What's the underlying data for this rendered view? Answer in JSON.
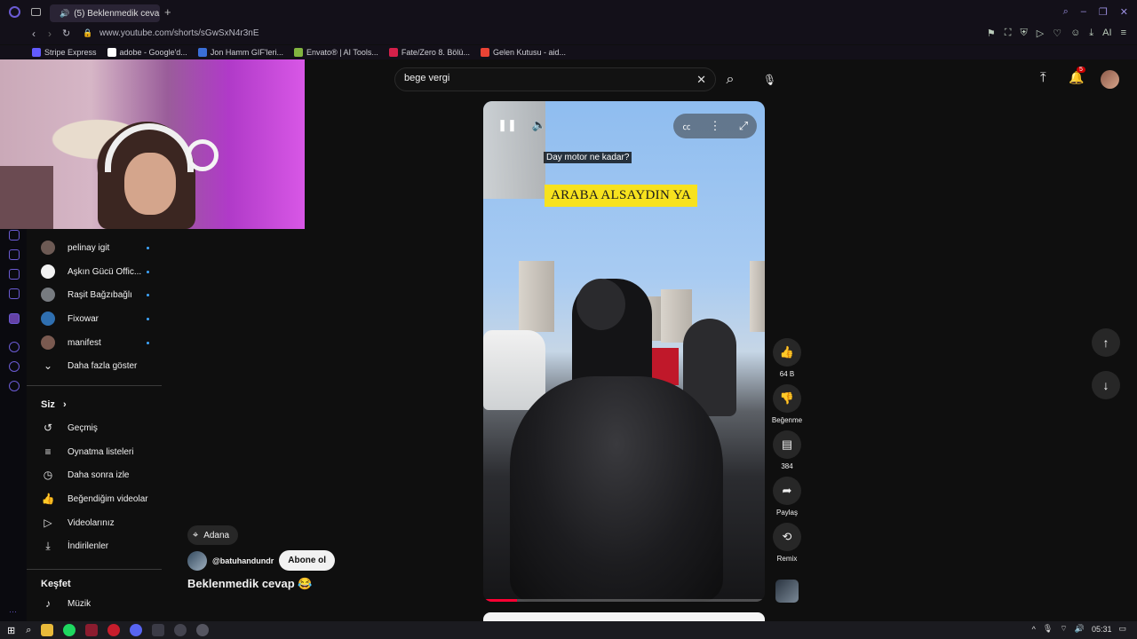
{
  "browser": {
    "tab_title": "(5) Beklenmedik cevap",
    "url": "www.youtube.com/shorts/sGwSxN4r3nE",
    "bookmarks": [
      {
        "label": "Stripe Express",
        "color": "#635bff"
      },
      {
        "label": "adobe - Google'd...",
        "color": "#ffffff"
      },
      {
        "label": "Jon Hamm GIF'leri...",
        "color": "#3a6fd8"
      },
      {
        "label": "Envato® | AI Tools...",
        "color": "#82b440"
      },
      {
        "label": "Fate/Zero 8. Bölü...",
        "color": "#d4204a"
      },
      {
        "label": "Gelen Kutusu - aid...",
        "color": "#ea4335"
      }
    ]
  },
  "search": {
    "value": "bege vergi",
    "clear_icon": "✕",
    "search_icon": "⌕",
    "mic_icon": "🎙"
  },
  "header": {
    "notifications_count": "5"
  },
  "sidebar": {
    "subscriptions": [
      {
        "name": "pelinay igit",
        "color": "#6d5a54"
      },
      {
        "name": "Aşkın Gücü Offic...",
        "color": "#f2f2f2"
      },
      {
        "name": "Raşit Bağzıbağlı",
        "color": "#777b80"
      },
      {
        "name": "Fixowar",
        "color": "#2f6fb0"
      },
      {
        "name": "manifest",
        "color": "#7a5a50"
      }
    ],
    "show_more": "Daha fazla göster",
    "you_heading": "Siz",
    "you_items": [
      {
        "label": "Geçmiş",
        "icon": "↺"
      },
      {
        "label": "Oynatma listeleri",
        "icon": "≡"
      },
      {
        "label": "Daha sonra izle",
        "icon": "◷"
      },
      {
        "label": "Beğendiğim videolar",
        "icon": "👍"
      },
      {
        "label": "Videolarınız",
        "icon": "▷"
      },
      {
        "label": "İndirilenler",
        "icon": "⤓"
      }
    ],
    "explore_heading": "Keşfet",
    "explore_items": [
      {
        "label": "Müzik",
        "icon": "♪"
      }
    ]
  },
  "video": {
    "caption": "Day motor ne kadar?",
    "overlay_text": "ARABA ALSAYDIN YA",
    "progress": 0.12
  },
  "actions": {
    "likes": "64 B",
    "dislike": "Beğenme",
    "comments": "384",
    "share": "Paylaş",
    "remix": "Remix"
  },
  "meta": {
    "location": "Adana",
    "channel": "@batuhandundr",
    "subscribe": "Abone ol",
    "title": "Beklenmedik cevap 😂"
  },
  "taskbar": {
    "time": "05:31"
  }
}
